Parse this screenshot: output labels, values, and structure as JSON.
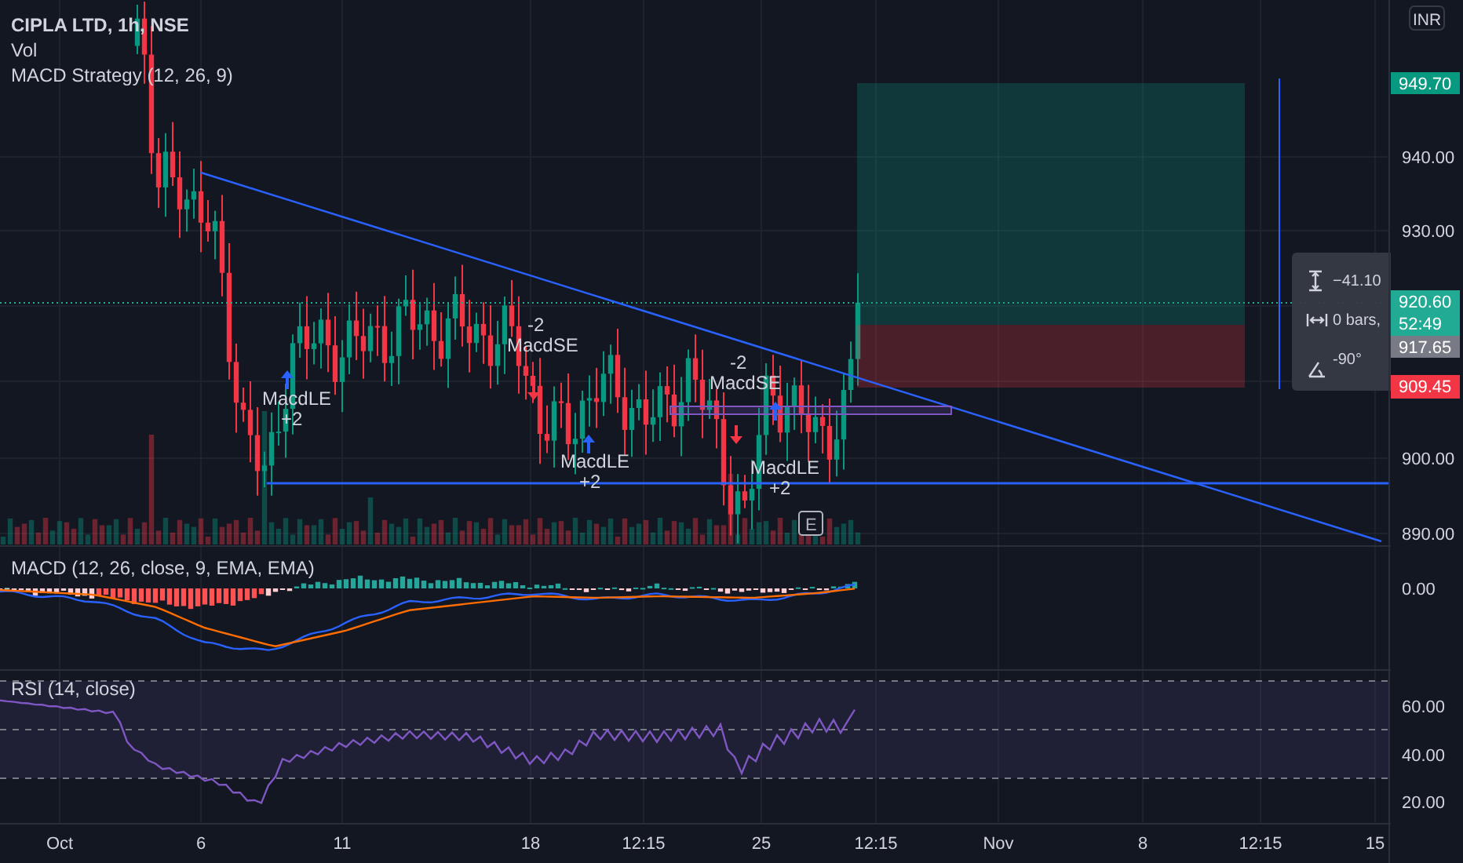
{
  "legend": {
    "title": "CIPLA LTD, 1h, NSE",
    "lines": [
      "Vol",
      "MACD Strategy (12, 26, 9)"
    ]
  },
  "currency": "INR",
  "price_axis": [
    "940.00",
    "930.00",
    "900.00",
    "890.00"
  ],
  "price_badges": [
    {
      "texts": [
        "949.70"
      ],
      "color": "#089981"
    },
    {
      "texts": [
        "920.60",
        "52:49"
      ],
      "color": "#22ab94"
    },
    {
      "texts": [
        "917.65"
      ],
      "color": "#787b86"
    },
    {
      "texts": [
        "909.45"
      ],
      "color": "#f23645"
    }
  ],
  "measure_tooltip": {
    "rows": [
      {
        "kind": "price",
        "text": "−41.10"
      },
      {
        "kind": "bars",
        "text": "0 bars,"
      },
      {
        "kind": "angle",
        "text": "-90°"
      }
    ]
  },
  "signals": [
    {
      "kind": "long",
      "label": "MacdLE",
      "qty": "+2"
    },
    {
      "kind": "short",
      "label": "MacdSE",
      "qty": "-2"
    },
    {
      "kind": "long",
      "label": "MacdLE",
      "qty": "+2"
    },
    {
      "kind": "short",
      "label": "MacdSE",
      "qty": "-2"
    },
    {
      "kind": "long",
      "label": "MacdLE",
      "qty": "+2"
    }
  ],
  "event_marker": "E",
  "macd_pane": {
    "legend": "MACD (12, 26, close, 9, EMA, EMA)",
    "axis": [
      "0.00"
    ]
  },
  "rsi_pane": {
    "legend": "RSI (14, close)",
    "axis": [
      "60.00",
      "40.00",
      "20.00"
    ]
  },
  "time_axis": [
    "Oct",
    "6",
    "11",
    "18",
    "12:15",
    "25",
    "12:15",
    "Nov",
    "8",
    "12:15",
    "15"
  ]
}
